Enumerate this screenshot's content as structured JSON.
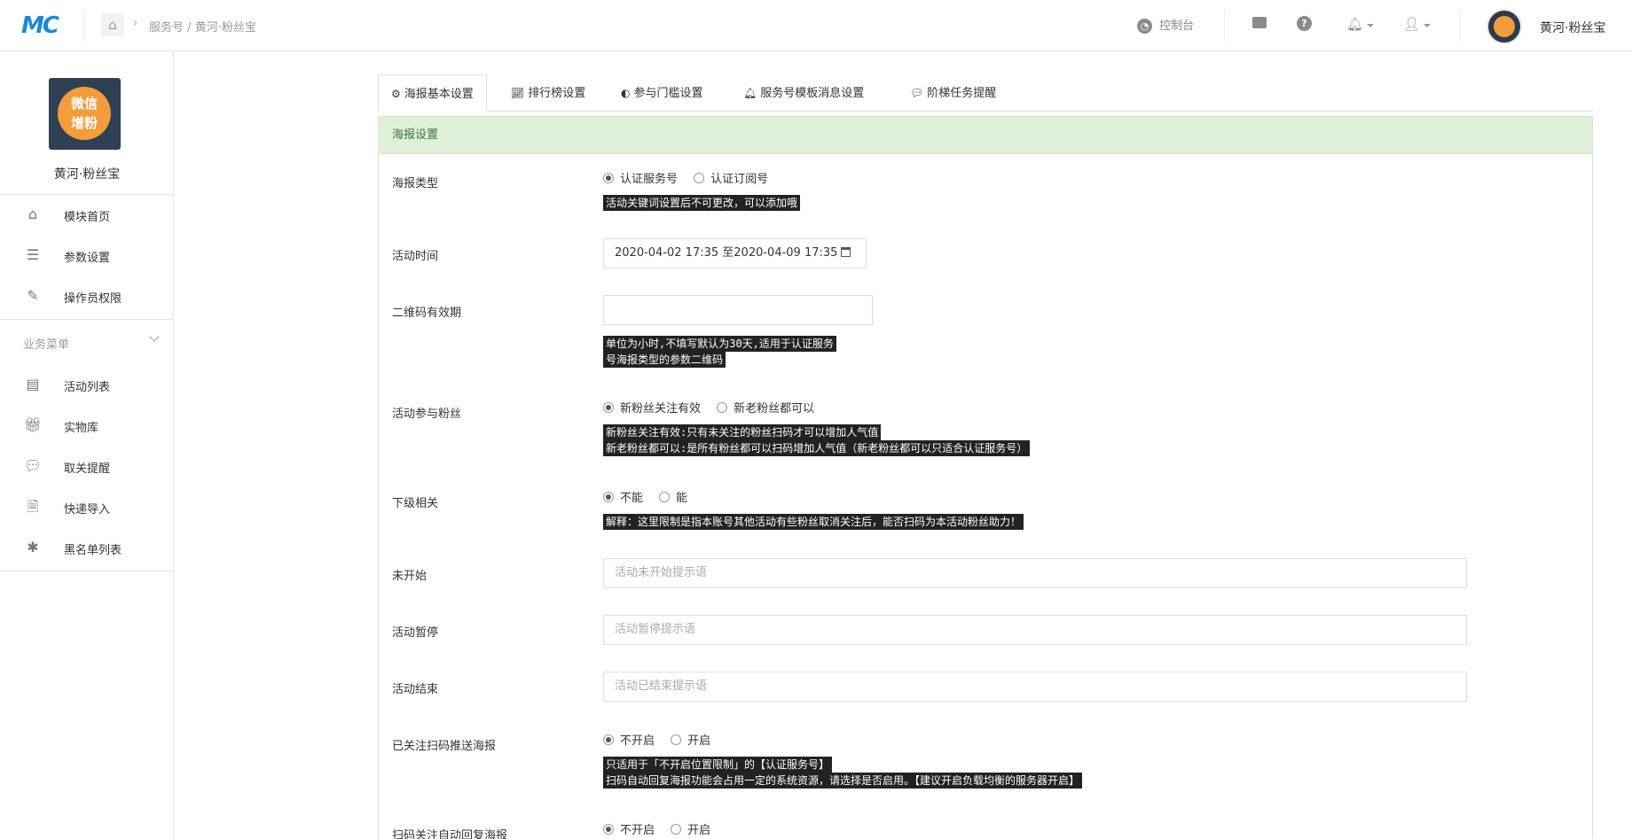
{
  "header": {
    "logo_text": "MC",
    "breadcrumb_parent": "服务号",
    "breadcrumb_sep": "/",
    "breadcrumb_current": "黄河·粉丝宝",
    "console_label": "控制台",
    "user_name": "黄河·粉丝宝"
  },
  "sidebar": {
    "account_name": "黄河·粉丝宝",
    "avatar_text_line1": "微信",
    "avatar_text_line2": "增粉",
    "items_top": [
      {
        "label": "模块首页",
        "icon": "home-icon"
      },
      {
        "label": "参数设置",
        "icon": "list-icon"
      },
      {
        "label": "操作员权限",
        "icon": "edit-doc-icon"
      }
    ],
    "group_label": "业务菜单",
    "items_group": [
      {
        "label": "活动列表",
        "icon": "server-icon"
      },
      {
        "label": "实物库",
        "icon": "gift-icon"
      },
      {
        "label": "取关提醒",
        "icon": "chat-icon"
      },
      {
        "label": "快递导入",
        "icon": "file-icon"
      },
      {
        "label": "黑名单列表",
        "icon": "bug-icon"
      }
    ]
  },
  "tabs": [
    {
      "label": "海报基本设置",
      "icon": "gear-icon",
      "active": true
    },
    {
      "label": "排行榜设置",
      "icon": "line-chart-icon",
      "active": false
    },
    {
      "label": "参与门槛设置",
      "icon": "toggle-icon",
      "active": false
    },
    {
      "label": "服务号模板消息设置",
      "icon": "bell-icon",
      "active": false
    },
    {
      "label": "阶梯任务提醒",
      "icon": "comments-icon",
      "active": false
    }
  ],
  "panel": {
    "title": "海报设置",
    "poster_type": {
      "label": "海报类型",
      "options": [
        "认证服务号",
        "认证订阅号"
      ],
      "selected": 0,
      "hint": "活动关键词设置后不可更改，可以添加哦"
    },
    "activity_time": {
      "label": "活动时间",
      "value": "2020-04-02 17:35 至2020-04-09 17:35"
    },
    "qr_validity": {
      "label": "二维码有效期",
      "value": "",
      "hint_line1": "单位为小时,不填写默认为30天,适用于认证服务",
      "hint_line2": "号海报类型的参数二维码"
    },
    "participants": {
      "label": "活动参与粉丝",
      "options": [
        "新粉丝关注有效",
        "新老粉丝都可以"
      ],
      "selected": 0,
      "hint_line1": "新粉丝关注有效:只有未关注的粉丝扫码才可以增加人气值",
      "hint_line2": "新老粉丝都可以:是所有粉丝都可以扫码增加人气值（新老粉丝都可以只适合认证服务号）"
    },
    "sub_level": {
      "label": "下级相关",
      "options": [
        "不能",
        "能"
      ],
      "selected": 0,
      "hint": "解释：这里限制是指本账号其他活动有些粉丝取消关注后，能否扫码为本活动粉丝助力！"
    },
    "not_started": {
      "label": "未开始",
      "placeholder": "活动未开始提示语"
    },
    "paused": {
      "label": "活动暂停",
      "placeholder": "活动暂停提示语"
    },
    "ended": {
      "label": "活动结束",
      "placeholder": "活动已结束提示语"
    },
    "followed_push": {
      "label": "已关注扫码推送海报",
      "options": [
        "不开启",
        "开启"
      ],
      "selected": 0,
      "hint_line1": "只适用于「不开启位置限制」的【认证服务号】",
      "hint_line2": "扫码自动回复海报功能会占用一定的系统资源，请选择是否启用。【建议开启负载均衡的服务器开启】"
    },
    "auto_reply": {
      "label": "扫码关注自动回复海报",
      "options": [
        "不开启",
        "开启"
      ],
      "selected": 0
    }
  }
}
